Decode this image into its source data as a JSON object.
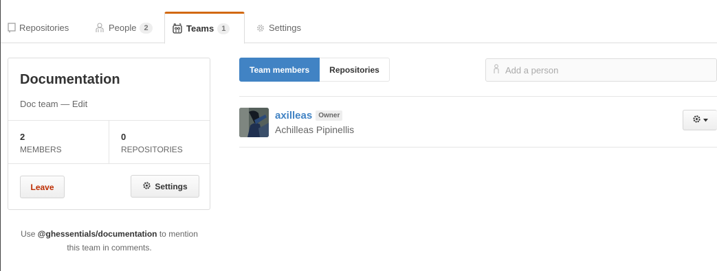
{
  "tabs": [
    {
      "label": "Repositories",
      "icon": "repo-icon"
    },
    {
      "label": "People",
      "count": "2",
      "icon": "people-icon"
    },
    {
      "label": "Teams",
      "count": "1",
      "icon": "teams-icon",
      "selected": true
    },
    {
      "label": "Settings",
      "icon": "gear-icon"
    }
  ],
  "team": {
    "name": "Documentation",
    "description": "Doc team",
    "separator": " — ",
    "edit_label": "Edit",
    "stats": [
      {
        "value": "2",
        "label": "MEMBERS"
      },
      {
        "value": "0",
        "label": "REPOSITORIES"
      }
    ],
    "leave_label": "Leave",
    "settings_label": "Settings"
  },
  "mention": {
    "prefix": "Use ",
    "handle": "@ghessentials/documentation",
    "suffix_line1": " to mention",
    "line2": "this team in comments."
  },
  "subnav": {
    "members_label": "Team members",
    "repositories_label": "Repositories"
  },
  "add_person": {
    "placeholder": "Add a person"
  },
  "members": [
    {
      "login": "axilleas",
      "badge": "Owner",
      "full_name": "Achilleas Pipinellis"
    }
  ],
  "colors": {
    "accent": "#4183c4",
    "tab_highlight": "#d26911",
    "leave": "#bd2c00"
  }
}
